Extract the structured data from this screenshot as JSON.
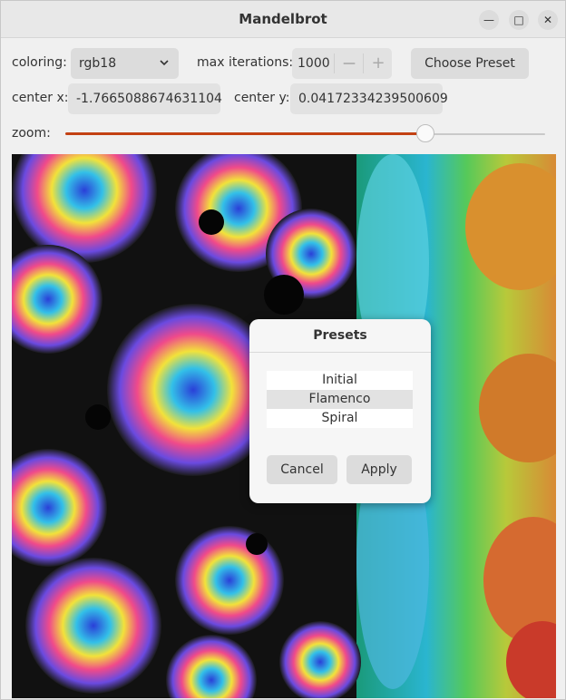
{
  "window": {
    "title": "Mandelbrot",
    "minimize_icon": "—",
    "maximize_icon": "□",
    "close_icon": "✕"
  },
  "controls": {
    "coloring_label": "coloring:",
    "coloring_value": "rgb18",
    "max_iterations_label": "max iterations:",
    "max_iterations_value": "1000",
    "decrement_label": "—",
    "increment_label": "+",
    "choose_preset_label": "Choose Preset",
    "center_x_label": "center x:",
    "center_x_value": "-1.7665088674631104",
    "center_y_label": "center y:",
    "center_y_value": "0.04172334239500609",
    "zoom_label": "zoom:",
    "zoom_fraction": 0.75
  },
  "dialog": {
    "title": "Presets",
    "presets": [
      "Initial",
      "Flamenco",
      "Spiral"
    ],
    "selected_preset": "Flamenco",
    "cancel_label": "Cancel",
    "apply_label": "Apply"
  },
  "colors": {
    "accent": "#c34113"
  }
}
